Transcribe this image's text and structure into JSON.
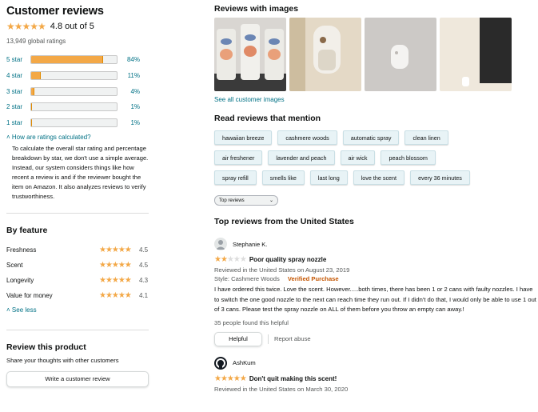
{
  "summary": {
    "title": "Customer reviews",
    "stars": "★★★★★",
    "rating_text": "4.8 out of 5",
    "rating": 4.8,
    "global_ratings": "13,949 global ratings",
    "histogram": [
      {
        "label": "5 star",
        "pct": "84%",
        "value": 84
      },
      {
        "label": "4 star",
        "pct": "11%",
        "value": 11
      },
      {
        "label": "3 star",
        "pct": "4%",
        "value": 4
      },
      {
        "label": "2 star",
        "pct": "1%",
        "value": 1
      },
      {
        "label": "1 star",
        "pct": "1%",
        "value": 1
      }
    ],
    "calc_link": "How are ratings calculated?",
    "calc_text": "To calculate the overall star rating and percentage breakdown by star, we don't use a simple average. Instead, our system considers things like how recent a review is and if the reviewer bought the item on Amazon. It also analyzes reviews to verify trustworthiness."
  },
  "by_feature": {
    "title": "By feature",
    "items": [
      {
        "name": "Freshness",
        "stars": "★★★★★",
        "value": "4.5"
      },
      {
        "name": "Scent",
        "stars": "★★★★★",
        "value": "4.5"
      },
      {
        "name": "Longevity",
        "stars": "★★★★★",
        "value": "4.3"
      },
      {
        "name": "Value for money",
        "stars": "★★★★★",
        "value": "4.1"
      }
    ],
    "see_less": "See less"
  },
  "review_product": {
    "title": "Review this product",
    "share": "Share your thoughts with other customers",
    "button": "Write a customer review"
  },
  "images_section": {
    "title": "Reviews with images",
    "see_all": "See all customer images"
  },
  "mentions": {
    "title": "Read reviews that mention",
    "chips": [
      "hawaiian breeze",
      "cashmere woods",
      "automatic spray",
      "clean linen",
      "air freshener",
      "lavender and peach",
      "air wick",
      "peach blossom",
      "spray refill",
      "smells like",
      "last long",
      "love the scent",
      "every 36 minutes"
    ]
  },
  "sort": {
    "selected": "Top reviews",
    "chevron": "⌄"
  },
  "top_reviews": {
    "title": "Top reviews from the United States",
    "reviews": [
      {
        "reviewer": "Stephanie K.",
        "stars": "★★",
        "stars_empty": "★★★",
        "rating": 2,
        "title": "Poor quality spray nozzle",
        "date": "Reviewed in the United States on August 23, 2019",
        "style": "Style: Cashmere Woods",
        "verified": "Verified Purchase",
        "body": "I have ordered this twice. Love the scent. However.....both times, there has been 1 or 2 cans with faulty nozzles. I have to switch the one good nozzle to the next can reach time they run out. If I didn't do that, I would only be able to use 1 out of 3 cans. Please test the spray nozzle on ALL of them before you throw an empty can away.!",
        "helpful_count": "35 people found this helpful",
        "helpful_btn": "Helpful",
        "report": "Report abuse"
      },
      {
        "reviewer": "AshKum",
        "stars": "★★★★★",
        "rating": 5,
        "title": "Don't quit making this scent!",
        "date": "Reviewed in the United States on March 30, 2020"
      }
    ]
  },
  "colors": {
    "star": "#f3a847",
    "link": "#007185",
    "verified": "#c45500"
  }
}
